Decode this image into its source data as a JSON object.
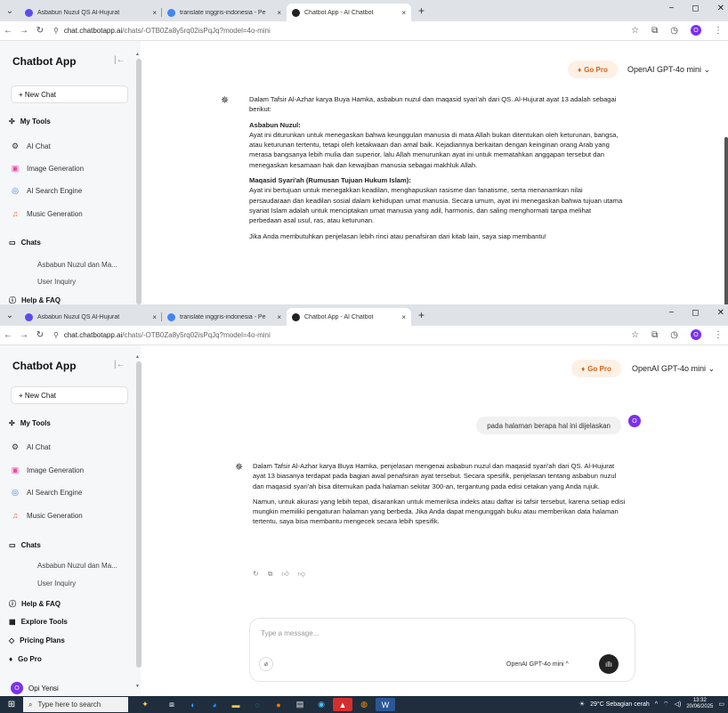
{
  "tabs": [
    {
      "title": "Asbabun Nuzul QS Al-Hujurat",
      "close": "×",
      "color": "#5b4cf0"
    },
    {
      "title": "translate inggris-indonesia - Pe",
      "close": "×",
      "color": "#4285f4"
    },
    {
      "title": "Chatbot App - AI Chatbot",
      "close": "×",
      "color": "#222222"
    }
  ],
  "new_tab": "+",
  "window_controls": {
    "minimize": "−",
    "maximize": "◻",
    "close": "✕"
  },
  "address": {
    "domain": "chat.chatbotapp.ai",
    "path": "/chats/-OTB0Za8y5rq02isPqJq?model=4o-mini"
  },
  "profile_initial": "O",
  "sidebar": {
    "title": "Chatbot App",
    "new_chat": "+ New Chat",
    "my_tools": "My Tools",
    "tools": [
      {
        "label": "AI Chat",
        "icon": "⚙",
        "color": "#333"
      },
      {
        "label": "Image Generation",
        "icon": "▣",
        "color": "#e94aa6"
      },
      {
        "label": "AI Search Engine",
        "icon": "◎",
        "color": "#2f7be5"
      },
      {
        "label": "Music Generation",
        "icon": "♫",
        "color": "#f06a3f"
      }
    ],
    "chats_label": "Chats",
    "chats": [
      "Asbabun Nuzul dan Ma...",
      "User Inquiry"
    ],
    "help": "Help & FAQ",
    "explore": "Explore Tools",
    "pricing": "Pricing Plans",
    "gopro": "Go Pro",
    "user_name": "Opi Yensi",
    "user_initial": "O"
  },
  "header": {
    "gopro": "Go Pro",
    "model": "OpenAI GPT-4o mini"
  },
  "chat1": {
    "intro": "Dalam Tafsir Al-Azhar karya Buya Hamka, asbabun nuzul dan maqasid syari'ah dari QS. Al-Hujurat ayat 13 adalah sebagai berikut:",
    "h1": "Asbabun Nuzul:",
    "p1": "Ayat ini diturunkan untuk menegaskan bahwa keunggulan manusia di mata Allah bukan ditentukan oleh keturunan, bangsa, atau keturunan tertentu, tetapi oleh ketakwaan dan amal baik. Kejadiannya berkaitan dengan keinginan orang Arab yang merasa bangsanya lebih mulia dan superior, lalu Allah menurunkan ayat ini untuk mematahkan anggapan tersebut dan menegaskan kesamaan hak dan kewajiban manusia sebagai makhluk Allah.",
    "h2": "Maqasid Syari'ah (Rumusan Tujuan Hukum Islam):",
    "p2": "Ayat ini bertujuan untuk menegakkan keadilan, menghapuskan rasisme dan fanatisme, serta menanamkan nilai persaudaraan dan keadilan sosial dalam kehidupan umat manusia. Secara umum, ayat ini menegaskan bahwa tujuan utama syariat Islam adalah untuk menciptakan umat manusia yang adil, harmonis, dan saling menghormati tanpa melihat perbedaan asal usul, ras, atau keturunan.",
    "p3": "Jika Anda membutuhkan penjelasan lebih rinci atau penafsiran dari kitab lain, saya siap membantu!"
  },
  "chat2": {
    "user_msg": "pada halaman berapa hal ini dijelaskan",
    "p1": "Dalam Tafsir Al-Azhar karya Buya Hamka, penjelasan mengenai asbabun nuzul dan maqasid syari'ah dari QS. Al-Hujurat ayat 13 biasanya terdapat pada bagian awal penafsiran ayat tersebut. Secara spesifik, penjelasan tentang asbabun nuzul dan maqasid syari'ah bisa ditemukan pada halaman sekitar 300-an, tergantung pada edisi cetakan yang Anda rujuk.",
    "p2": "Namun, untuk akurasi yang lebih tepat, disarankan untuk memeriksa indeks atau daftar isi tafsir tersebut, karena setiap edisi mungkin memiliki pengaturan halaman yang berbeda. Jika Anda dapat mengunggah buku atau memberikan data halaman tertentu, saya bisa membantu mengecek secara lebih spesifik."
  },
  "composer": {
    "placeholder": "Type a message...",
    "model": "OpenAI GPT-4o mini"
  },
  "taskbar": {
    "search": "Type here to search",
    "weather": "29°C  Sebagian cerah",
    "time": "13:32",
    "date": "20/06/2025"
  }
}
